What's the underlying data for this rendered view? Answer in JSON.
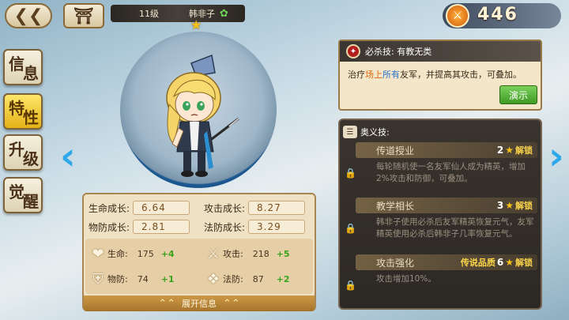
{
  "topbar": {
    "back_icon": "back-arrow-icon",
    "home_icon": "home-icon",
    "level": "11级",
    "hero_name": "韩非子",
    "leaf_icon": "leaf-icon",
    "stars": "★",
    "currency_value": "446"
  },
  "side_tabs": [
    {
      "c1": "信",
      "c2": "息",
      "active": false
    },
    {
      "c1": "特",
      "c2": "性",
      "active": true
    },
    {
      "c1": "升",
      "c2": "级",
      "active": false
    },
    {
      "c1": "觉",
      "c2": "醒",
      "active": false
    }
  ],
  "stats": {
    "growth": [
      {
        "label": "生命成长:",
        "value": "6.64"
      },
      {
        "label": "攻击成长:",
        "value": "8.27"
      },
      {
        "label": "物防成长:",
        "value": "2.81"
      },
      {
        "label": "法防成长:",
        "value": "3.29"
      }
    ],
    "attrs": [
      {
        "label": "生命:",
        "value": "175",
        "bonus": "+4",
        "icon": "heart-icon"
      },
      {
        "label": "攻击:",
        "value": "218",
        "bonus": "+5",
        "icon": "sword-icon"
      },
      {
        "label": "物防:",
        "value": "74",
        "bonus": "+1",
        "icon": "shield-icon"
      },
      {
        "label": "法防:",
        "value": "87",
        "bonus": "+2",
        "icon": "magic-shield-icon"
      }
    ],
    "expand_label": "展开信息"
  },
  "skill": {
    "header": "必杀技:  有教无类",
    "desc_pre": "治疗",
    "desc_hl1": "场上",
    "desc_hl2": "所有",
    "desc_post": "友军，并提高其攻击，可叠加。",
    "demo_label": "演示"
  },
  "mystic": {
    "header": "奥义技:",
    "items": [
      {
        "title": "传道授业",
        "req_text": "",
        "req_num": "2",
        "unlock": "解锁",
        "desc": "每轮随机使一名友军仙人成为精英，增加2%攻击和防御，可叠加。"
      },
      {
        "title": "教学相长",
        "req_text": "",
        "req_num": "3",
        "unlock": "解锁",
        "desc": "韩非子使用必杀后友军精英恢复元气，友军精英使用必杀后韩非子几率恢复元气。"
      },
      {
        "title": "攻击强化",
        "req_text": "传说品质",
        "req_num": "6",
        "unlock": "解锁",
        "desc": "攻击增加10%。"
      }
    ]
  }
}
